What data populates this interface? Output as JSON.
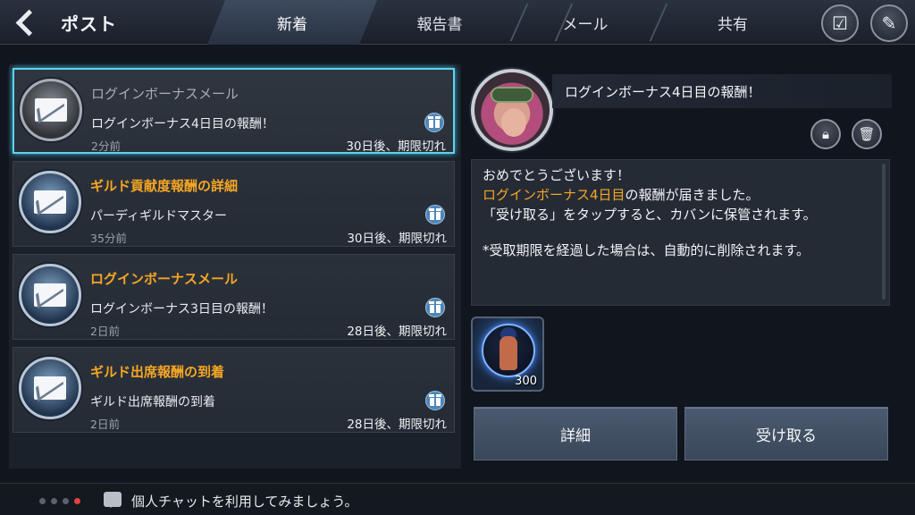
{
  "header": {
    "title": "ポスト",
    "tabs": [
      {
        "label": "新着",
        "active": true
      },
      {
        "label": "報告書",
        "active": false
      },
      {
        "label": "メール",
        "active": false
      },
      {
        "label": "共有",
        "active": false
      }
    ],
    "icons": [
      "back-chevron-icon",
      "checkbox-select-icon",
      "pencil-compose-icon"
    ]
  },
  "mails": [
    {
      "subject": "ログインボーナスメール",
      "sender": "ログインボーナス4日目の報酬！",
      "age": "2分前",
      "expiry": "30日後、期限切れ",
      "read": true,
      "selected": true
    },
    {
      "subject": "ギルド貢献度報酬の詳細",
      "sender": "パーディギルドマスター",
      "age": "35分前",
      "expiry": "30日後、期限切れ",
      "read": false,
      "selected": false
    },
    {
      "subject": "ログインボーナスメール",
      "sender": "ログインボーナス3日目の報酬！",
      "age": "2日前",
      "expiry": "28日後、期限切れ",
      "read": false,
      "selected": false
    },
    {
      "subject": "ギルド出席報酬の到着",
      "sender": "ギルド出席報酬の到着",
      "age": "2日前",
      "expiry": "28日後、期限切れ",
      "read": false,
      "selected": false
    }
  ],
  "detail": {
    "title": "ログインボーナス4日目の報酬！",
    "body": {
      "line1": "おめでとうございます！",
      "line2_highlight": "ログインボーナス4日目",
      "line2_rest": "の報酬が届きました。",
      "line3": "「受け取る」をタップすると、カバンに保管されます。",
      "warning": "*受取期限を経過した場合は、自動的に削除されます。"
    },
    "attachment_count": "300",
    "detail_button": "詳細",
    "receive_button": "受け取る"
  },
  "footer": {
    "chat_text": "個人チャットを利用してみましょう。"
  },
  "colors": {
    "accent_orange": "#f5a623",
    "warning_red": "#e2463c",
    "selected_border": "#5fd3ea"
  }
}
